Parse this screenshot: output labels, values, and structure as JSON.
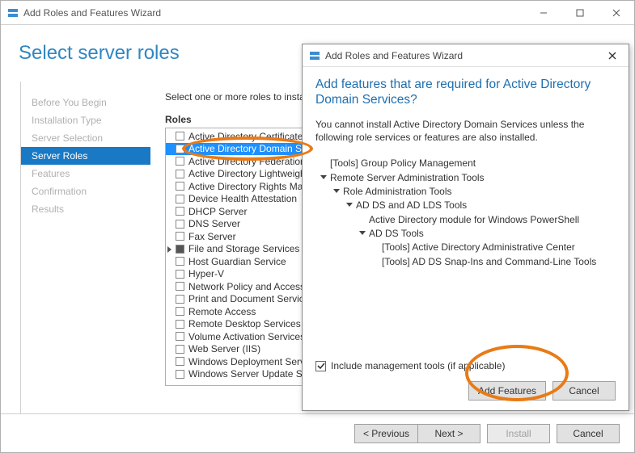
{
  "window": {
    "title": "Add Roles and Features Wizard"
  },
  "banner": {
    "title": "Select server roles"
  },
  "steps": {
    "items": [
      {
        "label": "Before You Begin"
      },
      {
        "label": "Installation Type"
      },
      {
        "label": "Server Selection"
      },
      {
        "label": "Server Roles"
      },
      {
        "label": "Features"
      },
      {
        "label": "Confirmation"
      },
      {
        "label": "Results"
      }
    ],
    "current_index": 3
  },
  "main": {
    "instruction": "Select one or more roles to install on the selected server.",
    "roles_label": "Roles",
    "roles": [
      "Active Directory Certificate Services",
      "Active Directory Domain Services",
      "Active Directory Federation Services",
      "Active Directory Lightweight Directory Services",
      "Active Directory Rights Management Services",
      "Device Health Attestation",
      "DHCP Server",
      "DNS Server",
      "Fax Server",
      "File and Storage Services",
      "Host Guardian Service",
      "Hyper-V",
      "Network Policy and Access Services",
      "Print and Document Services",
      "Remote Access",
      "Remote Desktop Services",
      "Volume Activation Services",
      "Web Server (IIS)",
      "Windows Deployment Services",
      "Windows Server Update Services"
    ],
    "selected_role_index": 1
  },
  "footer": {
    "previous": "< Previous",
    "next": "Next >",
    "install": "Install",
    "cancel": "Cancel"
  },
  "dialog": {
    "title": "Add Roles and Features Wizard",
    "heading": "Add features that are required for Active Directory Domain Services?",
    "text": "You cannot install Active Directory Domain Services unless the following role services or features are also installed.",
    "tree": {
      "n0": "[Tools] Group Policy Management",
      "n1": "Remote Server Administration Tools",
      "n2": "Role Administration Tools",
      "n3": "AD DS and AD LDS Tools",
      "n4": "Active Directory module for Windows PowerShell",
      "n5": "AD DS Tools",
      "n6": "[Tools] Active Directory Administrative Center",
      "n7": "[Tools] AD DS Snap-Ins and Command-Line Tools"
    },
    "include_label": "Include management tools (if applicable)",
    "include_checked": true,
    "add_features": "Add Features",
    "cancel": "Cancel"
  }
}
